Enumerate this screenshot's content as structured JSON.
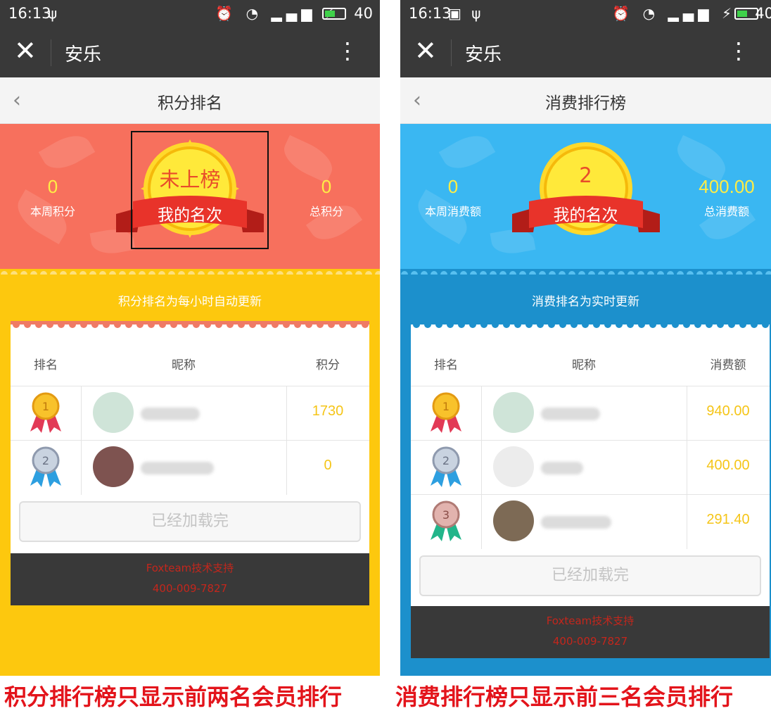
{
  "status": {
    "time": "16:13",
    "battery": "40"
  },
  "window": {
    "title": "安乐"
  },
  "left": {
    "page_title": "积分排名",
    "week_value": "0",
    "week_label": "本周积分",
    "rank_value": "未上榜",
    "rank_label": "我的名次",
    "total_value": "0",
    "total_label": "总积分",
    "note": "积分排名为每小时自动更新",
    "headers": {
      "rank": "排名",
      "name": "昵称",
      "score": "积分"
    },
    "rows": [
      {
        "medal": "1",
        "score": "1730"
      },
      {
        "medal": "2",
        "score": "0"
      }
    ],
    "loaded": "已经加载完",
    "support": "Foxteam技术支持",
    "phone": "400-009-7827",
    "caption": "积分排行榜只显示前两名会员排行"
  },
  "right": {
    "page_title": "消费排行榜",
    "week_value": "0",
    "week_label": "本周消费额",
    "rank_value": "2",
    "rank_label": "我的名次",
    "total_value": "400.00",
    "total_label": "总消费额",
    "note": "消费排名为实时更新",
    "headers": {
      "rank": "排名",
      "name": "昵称",
      "score": "消费额"
    },
    "rows": [
      {
        "medal": "1",
        "score": "940.00"
      },
      {
        "medal": "2",
        "score": "400.00"
      },
      {
        "medal": "3",
        "score": "291.40"
      }
    ],
    "loaded": "已经加载完",
    "support": "Foxteam技术支持",
    "phone": "400-009-7827",
    "caption": "消费排行榜只显示前三名会员排行"
  },
  "colors": {
    "topbar": "#393939",
    "left_hero": "#f7705d",
    "left_lower": "#fdc80e",
    "right_hero": "#3ab7f2",
    "right_lower": "#1c90cc",
    "score": "#f5c518",
    "caption": "#e3141b"
  }
}
